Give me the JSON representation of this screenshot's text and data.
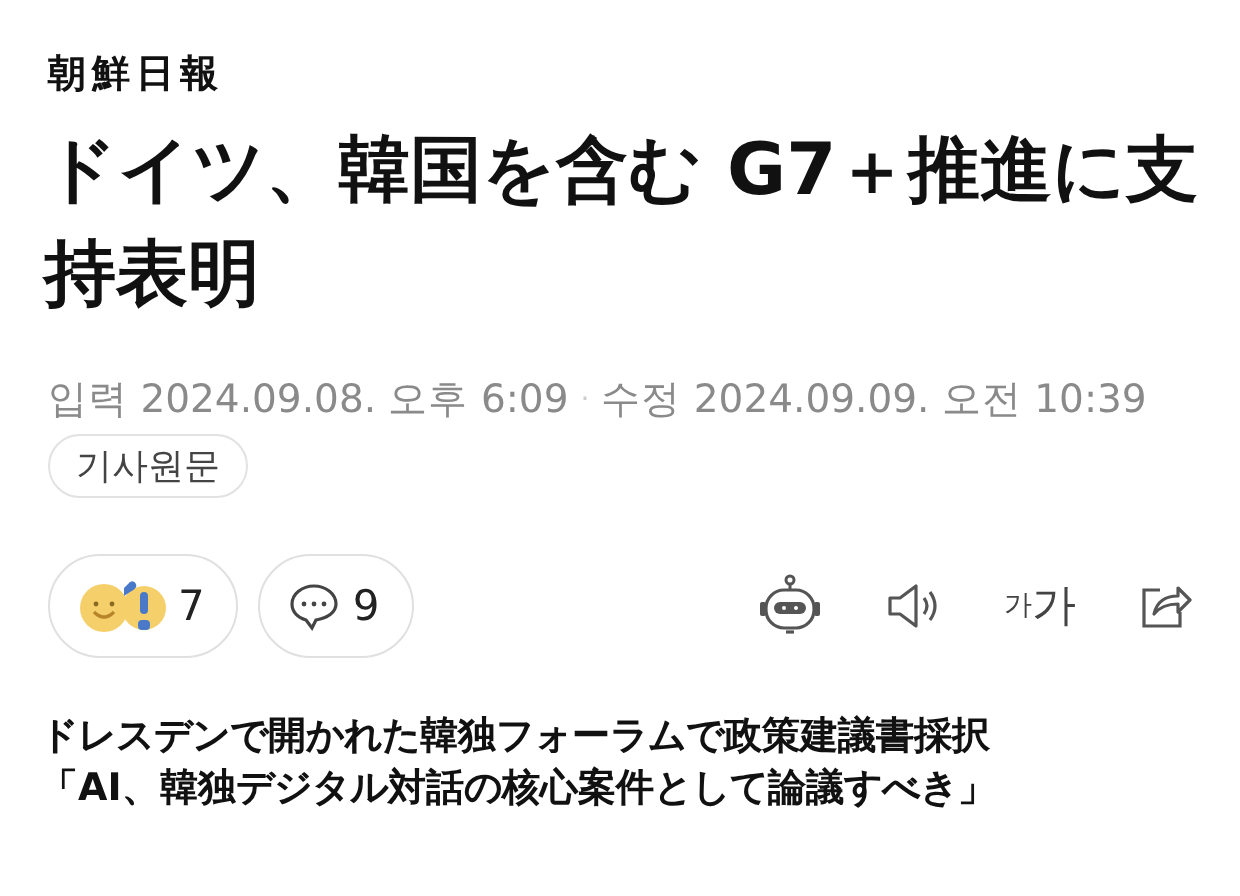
{
  "logo": "朝鮮日報",
  "headline": "ドイツ、韓国を含む G7＋推進に支持表明",
  "meta": {
    "input_label": "입력",
    "input_time": "2024.09.08. 오후 6:09",
    "separator": "·",
    "modified_label": "수정",
    "modified_time": "2024.09.09. 오전 10:39"
  },
  "original_button": "기사원문",
  "reactions": {
    "count": "7"
  },
  "comments": {
    "count": "9"
  },
  "font_size_button": {
    "small": "가",
    "large": "가"
  },
  "subheadlines": [
    "ドレスデンで開かれた韓独フォーラムで政策建議書採択",
    "「AI、韓独デジタル対話の核心案件として論議すべき」"
  ]
}
